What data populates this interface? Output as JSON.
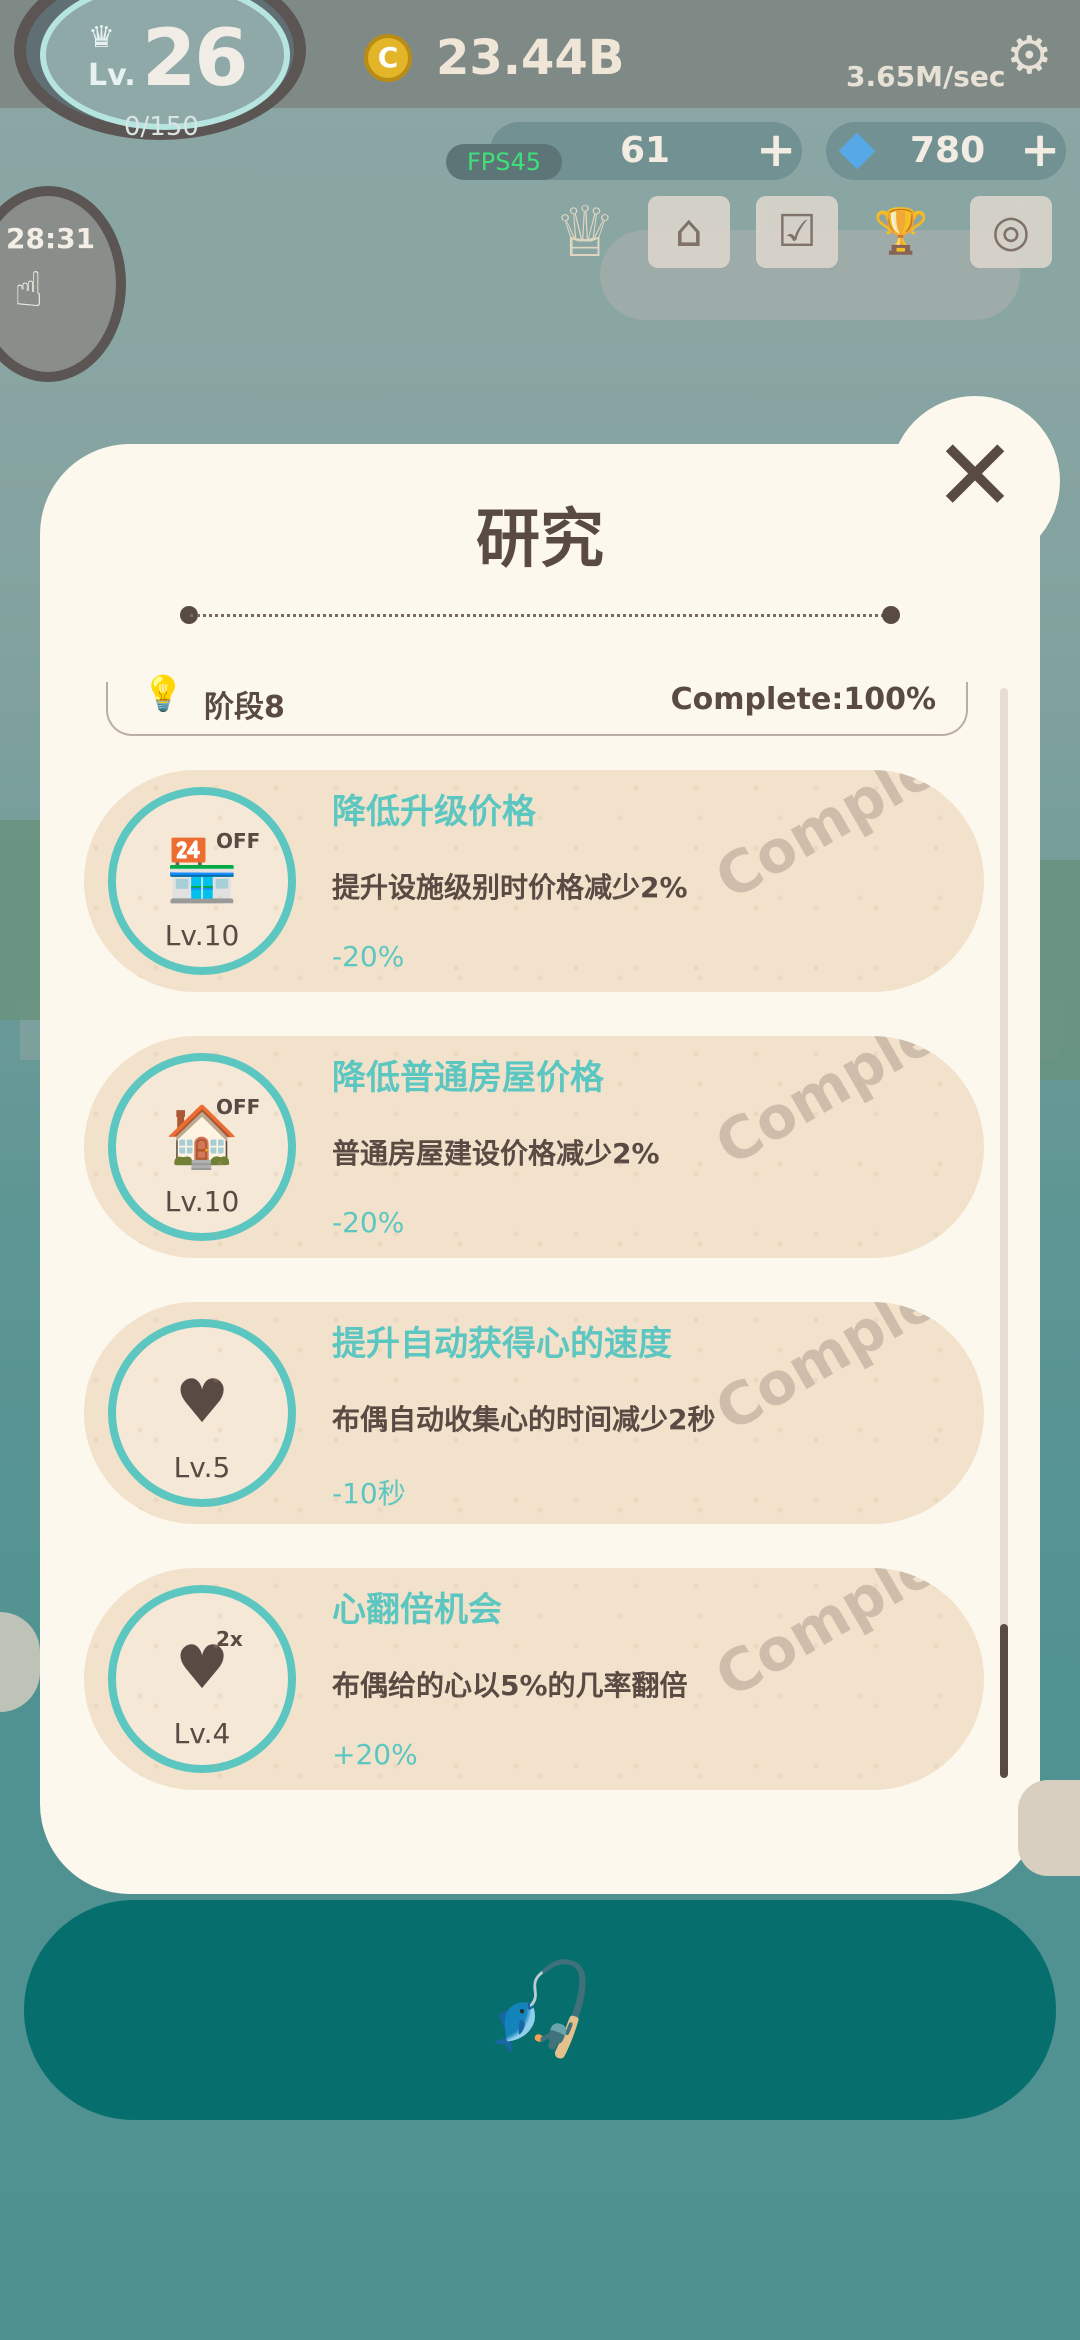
{
  "hud": {
    "level_prefix": "Lv.",
    "level": "26",
    "level_progress": "0/150",
    "coins": "23.44B",
    "coin_symbol": "C",
    "rate": "3.65M/sec",
    "hearts": "61",
    "gems": "780",
    "plus": "+",
    "fps": "FPS45",
    "timer": "28:31"
  },
  "icons": {
    "crown": "crown-icon",
    "shop": "shop-icon",
    "checklist": "checklist-icon",
    "trophy": "trophy-icon",
    "camera": "camera-icon",
    "settings": "gear-icon",
    "close": "close-icon",
    "fish": "fishing-icon"
  },
  "modal": {
    "title": "研究",
    "stage_label": "阶段8",
    "stage_status": "Complete:100%",
    "items": [
      {
        "title": "降低升级价格",
        "desc": "提升设施级别时价格减少2%",
        "effect": "-20%",
        "level": "Lv.10",
        "tag": "OFF",
        "stamp": "Complete"
      },
      {
        "title": "降低普通房屋价格",
        "desc": "普通房屋建设价格减少2%",
        "effect": "-20%",
        "level": "Lv.10",
        "tag": "OFF",
        "stamp": "Complete"
      },
      {
        "title": "提升自动获得心的速度",
        "desc": "布偶自动收集心的时间减少2秒",
        "effect": "-10秒",
        "level": "Lv.5",
        "tag": "",
        "stamp": "Complete"
      },
      {
        "title": "心翻倍机会",
        "desc": "布偶给的心以5%的几率翻倍",
        "effect": "+20%",
        "level": "Lv.4",
        "tag": "2x",
        "stamp": "Complete"
      }
    ]
  },
  "colors": {
    "accent": "#5cc6c1",
    "text": "#5a4a44",
    "card": "#f2e2cb",
    "action": "#066f6d"
  }
}
